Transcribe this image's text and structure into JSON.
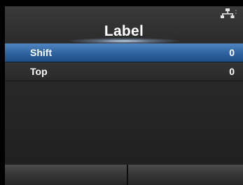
{
  "header": {
    "title": "Label",
    "status_icon": "network-icon"
  },
  "menu": {
    "items": [
      {
        "label": "Shift",
        "value": "0",
        "selected": true
      },
      {
        "label": "Top",
        "value": "0",
        "selected": false
      }
    ]
  },
  "footer": {
    "left_key_label": "",
    "right_key_label": ""
  },
  "colors": {
    "selected_row": "#2f65a3",
    "background": "#262626",
    "text": "#ffffff"
  }
}
